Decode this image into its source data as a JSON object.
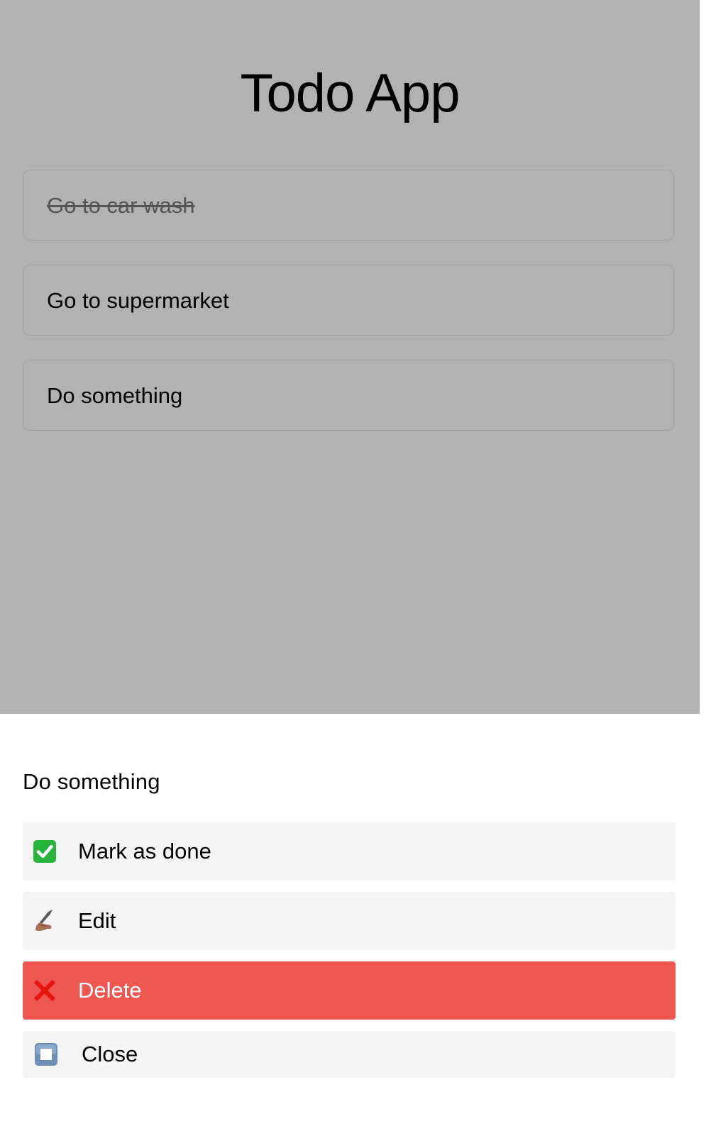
{
  "app": {
    "title": "Todo App"
  },
  "todos": [
    {
      "text": "Go to car wash",
      "done": true
    },
    {
      "text": "Go to supermarket",
      "done": false
    },
    {
      "text": "Do something",
      "done": false
    }
  ],
  "sheet": {
    "title": "Do something",
    "actions": [
      {
        "label": "Mark as done",
        "icon": "check-box-icon"
      },
      {
        "label": "Edit",
        "icon": "writing-hand-icon"
      },
      {
        "label": "Delete",
        "icon": "cross-mark-icon"
      },
      {
        "label": "Close",
        "icon": "stop-button-icon"
      }
    ]
  },
  "colors": {
    "danger": "#ee5651",
    "action_bg": "#f4f4f4",
    "overlay": "rgba(0,0,0,0.30)",
    "check_green": "#27b43c"
  }
}
